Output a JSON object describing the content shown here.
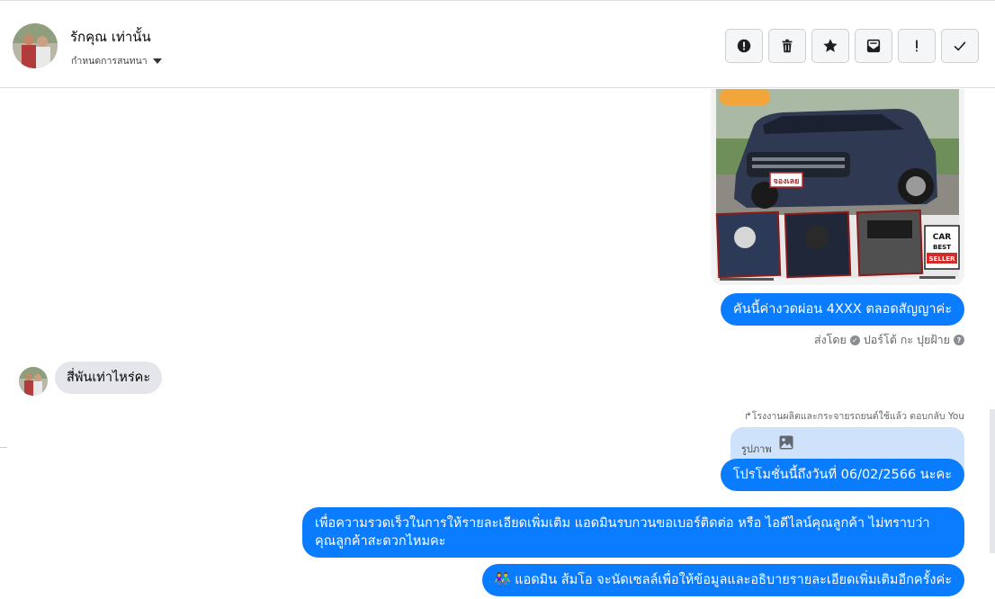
{
  "header": {
    "contact_name": "รักคุณ เท่านั้น",
    "settings_label": "กำหนดการสนทนา"
  },
  "toolbar": {
    "buttons": [
      {
        "icon": "alert-circle-icon",
        "label": "Mark as spam"
      },
      {
        "icon": "trash-icon",
        "label": "Delete"
      },
      {
        "icon": "star-icon",
        "label": "Star"
      },
      {
        "icon": "mail-unread-icon",
        "label": "Mark as unread"
      },
      {
        "icon": "exclamation-icon",
        "label": "Important"
      },
      {
        "icon": "check-icon",
        "label": "Done"
      }
    ]
  },
  "messages": {
    "out_1": "คันนี้ค่างวดผ่อน 4XXX ตลอดสัญญาค่ะ",
    "sent_by_prefix": "ส่งโดย",
    "sent_by_name": "ปอร์โต้ กะ ปุยฝ้าย",
    "in_1": "สี่พันเท่าไหร่คะ",
    "reply_meta": "โรงงานผลิตและกระจายรถยนต์ใช้แล้ว ตอบกลับ You",
    "reply_quote_label": "รูปภาพ",
    "out_2": "โปรโมชั่นนี้ถึงวันที่ 06/02/2566 นะคะ",
    "out_3_line1": "เพื่อความรวดเร็วในการให้รายละเอียดเพิ่มเติม แอดมินรบกวนขอเบอร์ติดต่อ หรือ ไอดีไลน์คุณลูกค้า ไม่ทราบว่า",
    "out_3_line2": "คุณลูกค้าสะดวกไหมคะ",
    "out_4": "แอดมิน ส้มโอ จะนัดเซลล์เพื่อให้ข้อมูลและอธิบายรายละเอียดเพิ่มเติมอีกครั้งค่ะ"
  },
  "car_image": {
    "badge_text": "จองเลย",
    "seller_badge_line1": "CAR",
    "seller_badge_line2": "BEST",
    "seller_badge_line3": "SELLER"
  },
  "colors": {
    "messenger_blue": "#0a7cff",
    "incoming_gray": "#e4e6eb",
    "reply_quote_bg": "#cfe2fb"
  }
}
